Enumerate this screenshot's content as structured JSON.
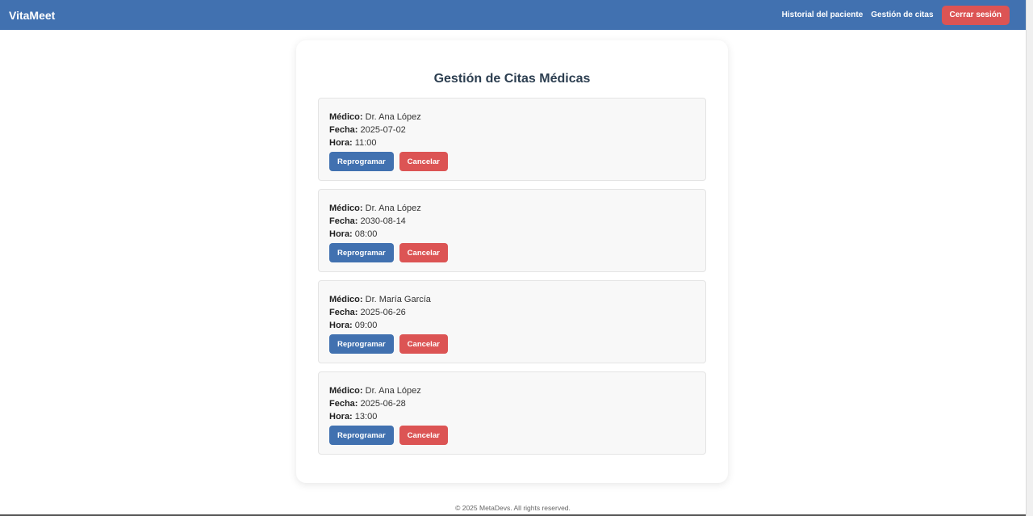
{
  "app": {
    "brand": "VitaMeet"
  },
  "nav": {
    "links": [
      "Historial del paciente",
      "Gestión de citas"
    ],
    "logout_label": "Cerrar sesión"
  },
  "page": {
    "title": "Gestión de Citas Médicas"
  },
  "labels": {
    "doctor": "Médico:",
    "date": "Fecha:",
    "time": "Hora:"
  },
  "buttons": {
    "reschedule": "Reprogramar",
    "cancel": "Cancelar"
  },
  "appointments": [
    {
      "doctor": "Dr. Ana López",
      "date": "2025-07-02",
      "time": "11:00"
    },
    {
      "doctor": "Dr. Ana López",
      "date": "2030-08-14",
      "time": "08:00"
    },
    {
      "doctor": "Dr. María García",
      "date": "2025-06-26",
      "time": "09:00"
    },
    {
      "doctor": "Dr. Ana López",
      "date": "2025-06-28",
      "time": "13:00"
    }
  ],
  "footer": {
    "text": "© 2025 MetaDevs. All rights reserved."
  },
  "colors": {
    "primary": "#4171b0",
    "danger": "#dc5454",
    "title": "#2c3e50"
  }
}
